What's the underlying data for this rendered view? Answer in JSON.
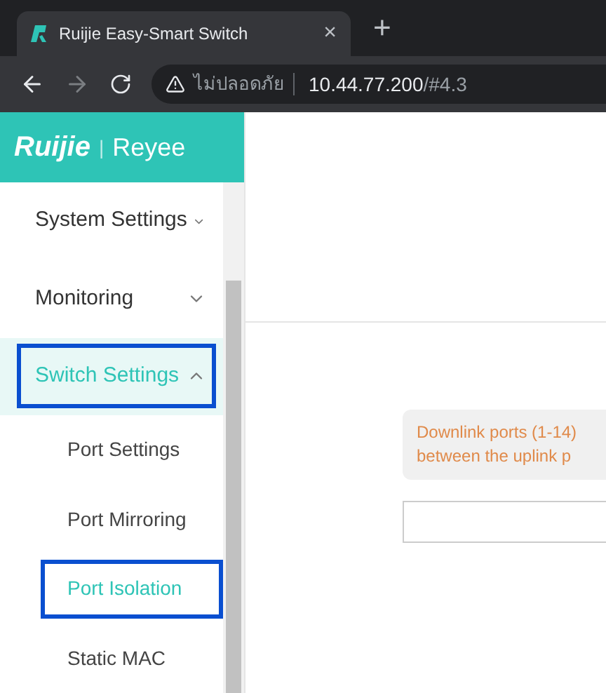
{
  "browser": {
    "tab": {
      "title": "Ruijie Easy-Smart Switch",
      "close": "×"
    },
    "new_tab": "+",
    "address": {
      "security": "ไม่ปลอดภัย",
      "host": "10.44.77.200",
      "path": "/#4.3"
    }
  },
  "logo": {
    "brand": "Ruijie",
    "separator": "|",
    "sub_brand": "Reyee"
  },
  "sidebar": {
    "items": [
      {
        "label": "System Settings",
        "expanded": false,
        "selected": false,
        "outlined": false
      },
      {
        "label": "Monitoring",
        "expanded": false,
        "selected": false,
        "outlined": false
      },
      {
        "label": "Switch Settings",
        "expanded": true,
        "selected": true,
        "outlined": true,
        "children": [
          {
            "label": "Port Settings",
            "selected": false,
            "outlined": false
          },
          {
            "label": "Port Mirroring",
            "selected": false,
            "outlined": false
          },
          {
            "label": "Port Isolation",
            "selected": true,
            "outlined": true
          },
          {
            "label": "Static MAC",
            "selected": false,
            "outlined": false
          }
        ]
      }
    ]
  },
  "notice": {
    "lines": [
      "Downlink ports (1-14)",
      "between the uplink p"
    ]
  }
}
